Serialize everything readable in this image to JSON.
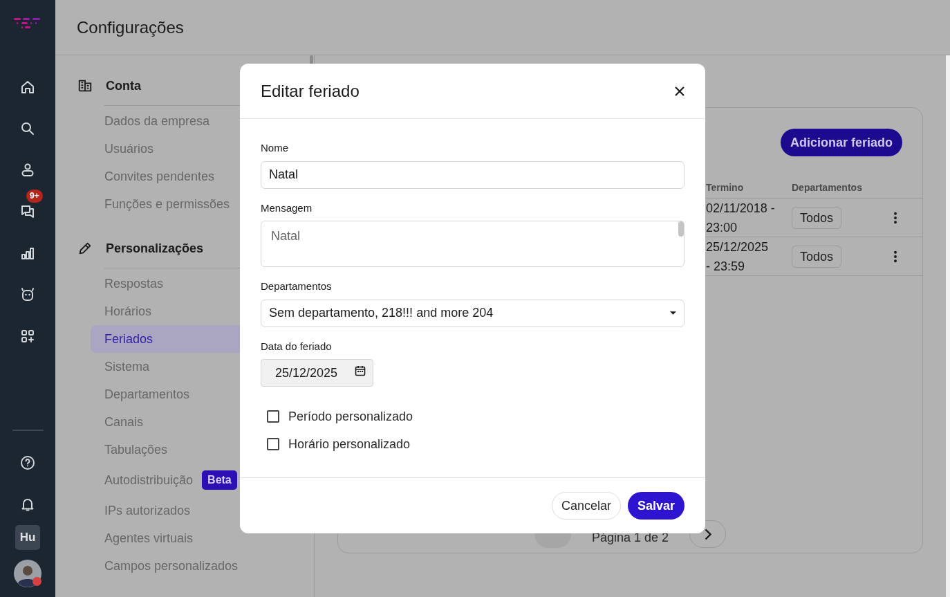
{
  "app_sidebar": {
    "nav": [
      {
        "kind": "home"
      },
      {
        "kind": "search"
      },
      {
        "kind": "person"
      },
      {
        "kind": "chat",
        "badge": "9+"
      },
      {
        "kind": "chart"
      },
      {
        "kind": "robot"
      },
      {
        "kind": "apps"
      }
    ],
    "bottom": [
      {
        "kind": "help"
      },
      {
        "kind": "bell"
      }
    ],
    "workspace": "Hu"
  },
  "page_title": "Configurações",
  "settings_nav": {
    "sections": [
      {
        "title": "Conta",
        "kind": "building",
        "items": [
          {
            "label": "Dados da empresa",
            "selected": false
          },
          {
            "label": "Usuários",
            "selected": false
          },
          {
            "label": "Convites pendentes",
            "selected": false
          },
          {
            "label": "Funções e permissões",
            "selected": false
          }
        ]
      },
      {
        "title": "Personalizações",
        "kind": "pencil",
        "items": [
          {
            "label": "Respostas",
            "selected": false
          },
          {
            "label": "Horários",
            "selected": false
          },
          {
            "label": "Feriados",
            "selected": true
          },
          {
            "label": "Sistema",
            "selected": false
          },
          {
            "label": "Departamentos",
            "selected": false
          },
          {
            "label": "Canais",
            "selected": false
          },
          {
            "label": "Tabulações",
            "selected": false
          },
          {
            "label": "Autodistribuição",
            "selected": false,
            "badge": "Beta"
          },
          {
            "label": "IPs autorizados",
            "selected": false
          },
          {
            "label": "Agentes virtuais",
            "selected": false
          },
          {
            "label": "Campos personalizados",
            "selected": false
          }
        ]
      }
    ]
  },
  "holidays": {
    "add_button": "Adicionar feriado",
    "columns": [
      "Termino",
      "Departamentos"
    ],
    "rows": [
      {
        "termino": "02/11/2018 - 23:00",
        "departamentos": "Todos"
      },
      {
        "termino": "25/12/2025 - 23:59",
        "departamentos": "Todos"
      }
    ],
    "pagination": "Página 1 de 2"
  },
  "dialog": {
    "title": "Editar feriado",
    "fields": [
      {
        "kind": "text",
        "label": "Nome",
        "value": "Natal"
      },
      {
        "kind": "textarea",
        "label": "Mensagem",
        "value": "Natal"
      },
      {
        "kind": "select",
        "label": "Departamentos",
        "value": "Sem departamento, 218!!! and more 204"
      },
      {
        "kind": "date",
        "label": "Data do feriado",
        "value": "25/12/2025"
      }
    ],
    "checkboxes": [
      {
        "label": "Período personalizado",
        "checked": false
      },
      {
        "label": "Horário personalizado",
        "checked": false
      }
    ],
    "buttons": [
      {
        "label": "Cancelar",
        "kind": "secondary"
      },
      {
        "label": "Salvar",
        "kind": "primary"
      }
    ]
  }
}
